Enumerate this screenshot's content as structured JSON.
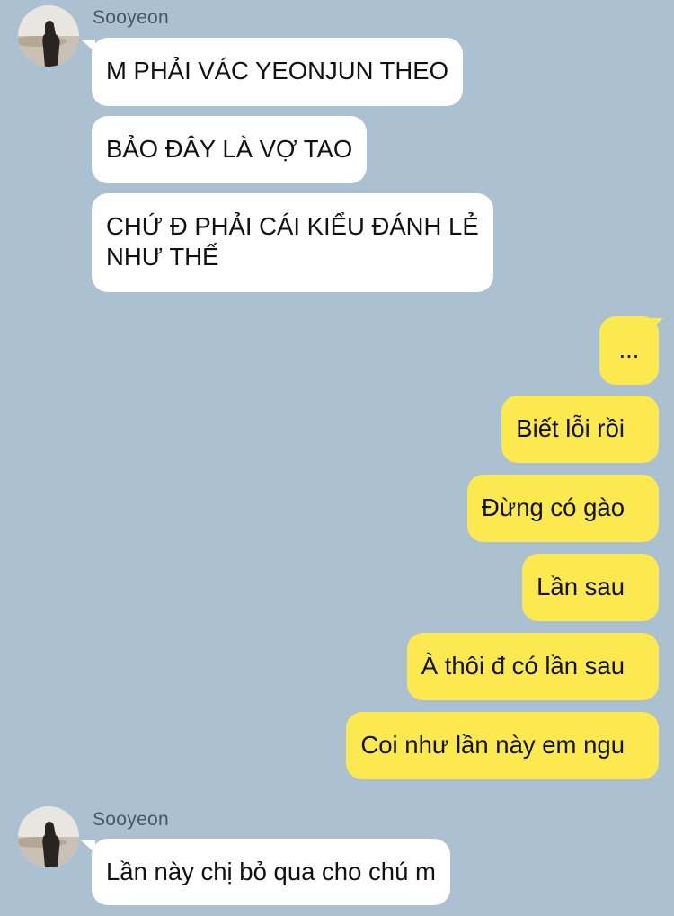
{
  "conversation": {
    "groups": [
      {
        "sender": "Sooyeon",
        "avatar_icon": "profile-photo-avatar",
        "messages": [
          "M PHẢI VÁC YEONJUN THEO",
          "BẢO ĐÂY LÀ VỢ TAO",
          "CHỨ Đ PHẢI CÁI KIỂU ĐÁNH LẺ\nNHƯ THẾ"
        ]
      },
      {
        "sender": "me",
        "messages": [
          "...",
          "Biết lỗi rồi",
          "Đừng có gào",
          "Lần sau",
          "À thôi đ có lần sau",
          "Coi như lần này em ngu"
        ]
      },
      {
        "sender": "Sooyeon",
        "avatar_icon": "profile-photo-avatar",
        "messages": [
          "Lần này chị bỏ qua cho chú m"
        ]
      }
    ]
  },
  "colors": {
    "background": "#abc1d1",
    "incoming_bubble": "#ffffff",
    "outgoing_bubble": "#fbe94f"
  }
}
